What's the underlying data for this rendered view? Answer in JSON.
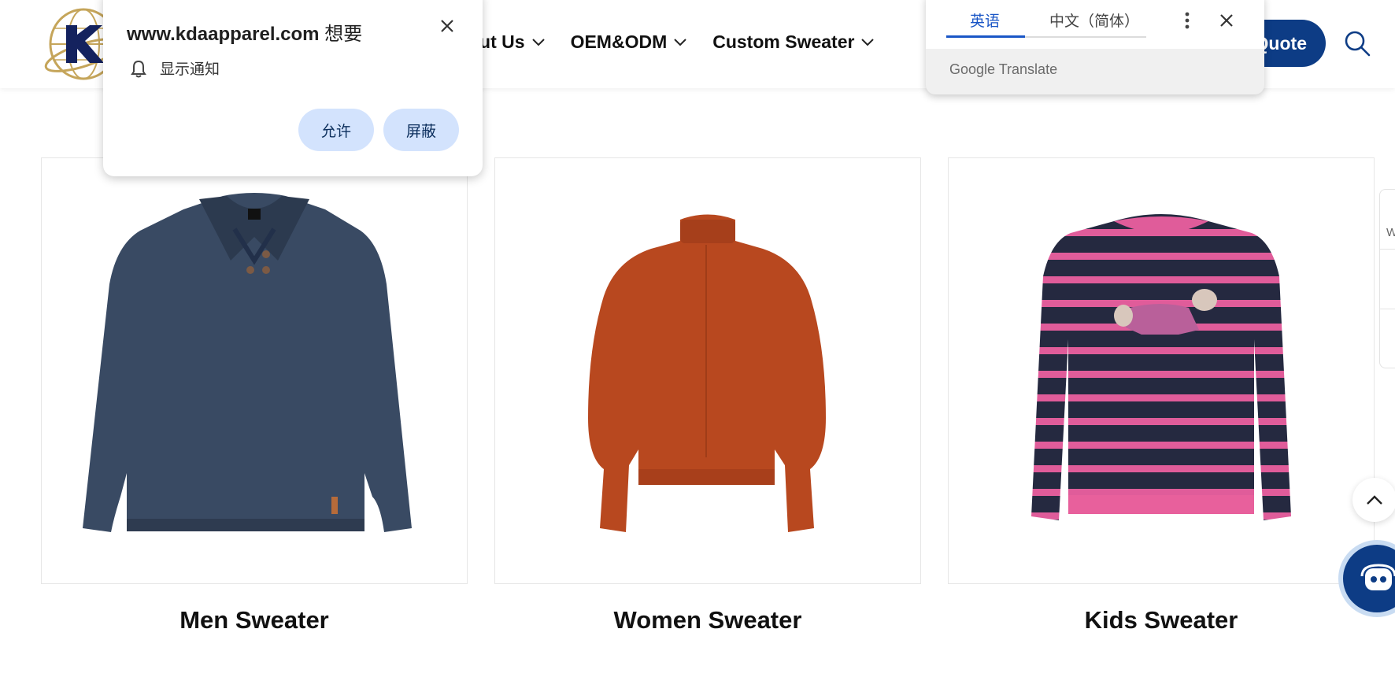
{
  "header": {
    "nav_items": [
      {
        "label": "out Us"
      },
      {
        "label": "OEM&ODM"
      },
      {
        "label": "Custom Sweater"
      }
    ],
    "quote_button": "Quote"
  },
  "products": [
    {
      "title": "Men Sweater"
    },
    {
      "title": "Women Sweater"
    },
    {
      "title": "Kids Sweater"
    }
  ],
  "side_tab": {
    "label": "W"
  },
  "notification_popup": {
    "site": "www.kdaapparel.com",
    "wants": "想要",
    "permission": "显示通知",
    "allow": "允许",
    "block": "屏蔽"
  },
  "translate_popup": {
    "tab_source": "英语",
    "tab_target": "中文（简体）",
    "brand": "Google Translate"
  },
  "colors": {
    "brand_navy": "#0d3c85",
    "permission_button": "#d3e3fd",
    "translate_accent": "#1a56c6"
  },
  "icons": [
    "logo-globe-icon",
    "chevron-down-icon",
    "search-icon",
    "close-icon",
    "bell-icon",
    "more-vert-icon",
    "chevron-up-icon",
    "chatbot-icon"
  ]
}
